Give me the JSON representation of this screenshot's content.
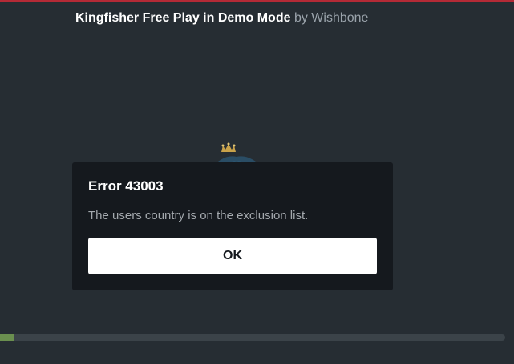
{
  "header": {
    "game_title": "Kingfisher Free Play in Demo Mode",
    "by_label": "by Wishbone"
  },
  "dialog": {
    "title": "Error 43003",
    "message": "The users country is on the exclusion list.",
    "ok_label": "OK"
  },
  "loader": {
    "progress": 0.028
  },
  "colors": {
    "background": "#262d33",
    "dialog_background": "#15191e",
    "accent_top": "#b42a36",
    "progress_fill": "#6a8f4f",
    "progress_track": "#3b4349"
  }
}
